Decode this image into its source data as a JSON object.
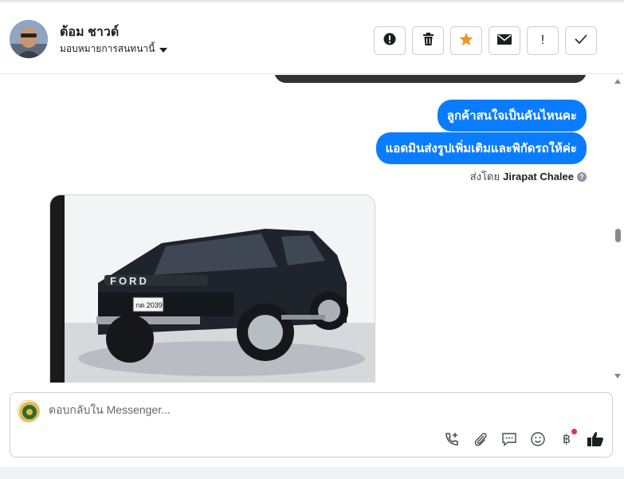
{
  "header": {
    "contact_name": "ต้อม ชาวด์",
    "assign_label": "มอบหมายการสนทนานี้",
    "toolbar": [
      {
        "name": "spam-button",
        "glyph": "!",
        "icon": "alert-circle-icon"
      },
      {
        "name": "delete-button",
        "glyph": "🗑",
        "icon": "trash-icon"
      },
      {
        "name": "star-button",
        "glyph": "★",
        "icon": "star-icon"
      },
      {
        "name": "mark-unread-button",
        "glyph": "✉",
        "icon": "envelope-icon"
      },
      {
        "name": "follow-up-button",
        "glyph": "!",
        "icon": "exclamation-icon"
      },
      {
        "name": "done-button",
        "glyph": "✓",
        "icon": "check-icon"
      }
    ]
  },
  "messages": {
    "outgoing_1": "ลูกค้าสนใจเป็นคันไหนคะ",
    "outgoing_2": "แอดมินส่งรูปเพิ่มเติมและพิกัดรถให้ค่ะ",
    "sent_by_prefix": "ส่งโดย",
    "sent_by_agent": "Jirapat Chalee",
    "help_glyph": "?",
    "photo": {
      "grille_text": "FORD",
      "plate_text": "กต 2039"
    }
  },
  "composer": {
    "placeholder": "ตอบกลับใน Messenger...",
    "tools": [
      {
        "name": "call-add-icon",
        "glyph": "📞"
      },
      {
        "name": "attach-icon",
        "glyph": "📎"
      },
      {
        "name": "saved-reply-icon",
        "glyph": "💬"
      },
      {
        "name": "emoji-icon",
        "glyph": "☺"
      },
      {
        "name": "payment-icon",
        "glyph": "฿"
      },
      {
        "name": "like-icon",
        "glyph": "👍"
      }
    ]
  },
  "colors": {
    "accent": "#0a7cff",
    "star": "#f0952a",
    "notification": "#f02849"
  }
}
